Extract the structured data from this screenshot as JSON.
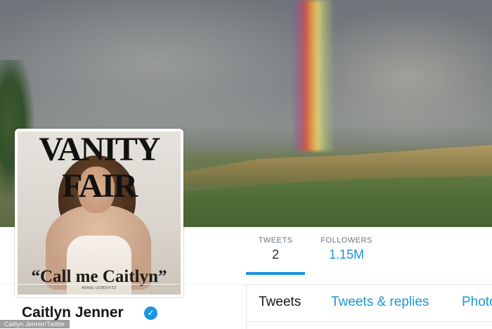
{
  "colors": {
    "accent": "#1b95e0",
    "text": "#14171a",
    "muted": "#66757f",
    "border": "#e1e8ed"
  },
  "avatar": {
    "cover_title": "VANITY FAIR",
    "cover_quote": "“Call me Caitlyn”",
    "cover_small": "ANNIE LEIBOVITZ"
  },
  "profile_nav": {
    "tweets": {
      "label": "TWEETS",
      "value": "2"
    },
    "followers": {
      "label": "FOLLOWERS",
      "value": "1.15M"
    }
  },
  "profile": {
    "name": "Caitlyn Jenner",
    "verified_icon": "verified-badge-icon"
  },
  "tabs": [
    {
      "label": "Tweets",
      "active": true
    },
    {
      "label": "Tweets & replies",
      "active": false
    },
    {
      "label": "Photos",
      "active": false
    }
  ],
  "credit": "Caitlyn Jenner/Twitter"
}
